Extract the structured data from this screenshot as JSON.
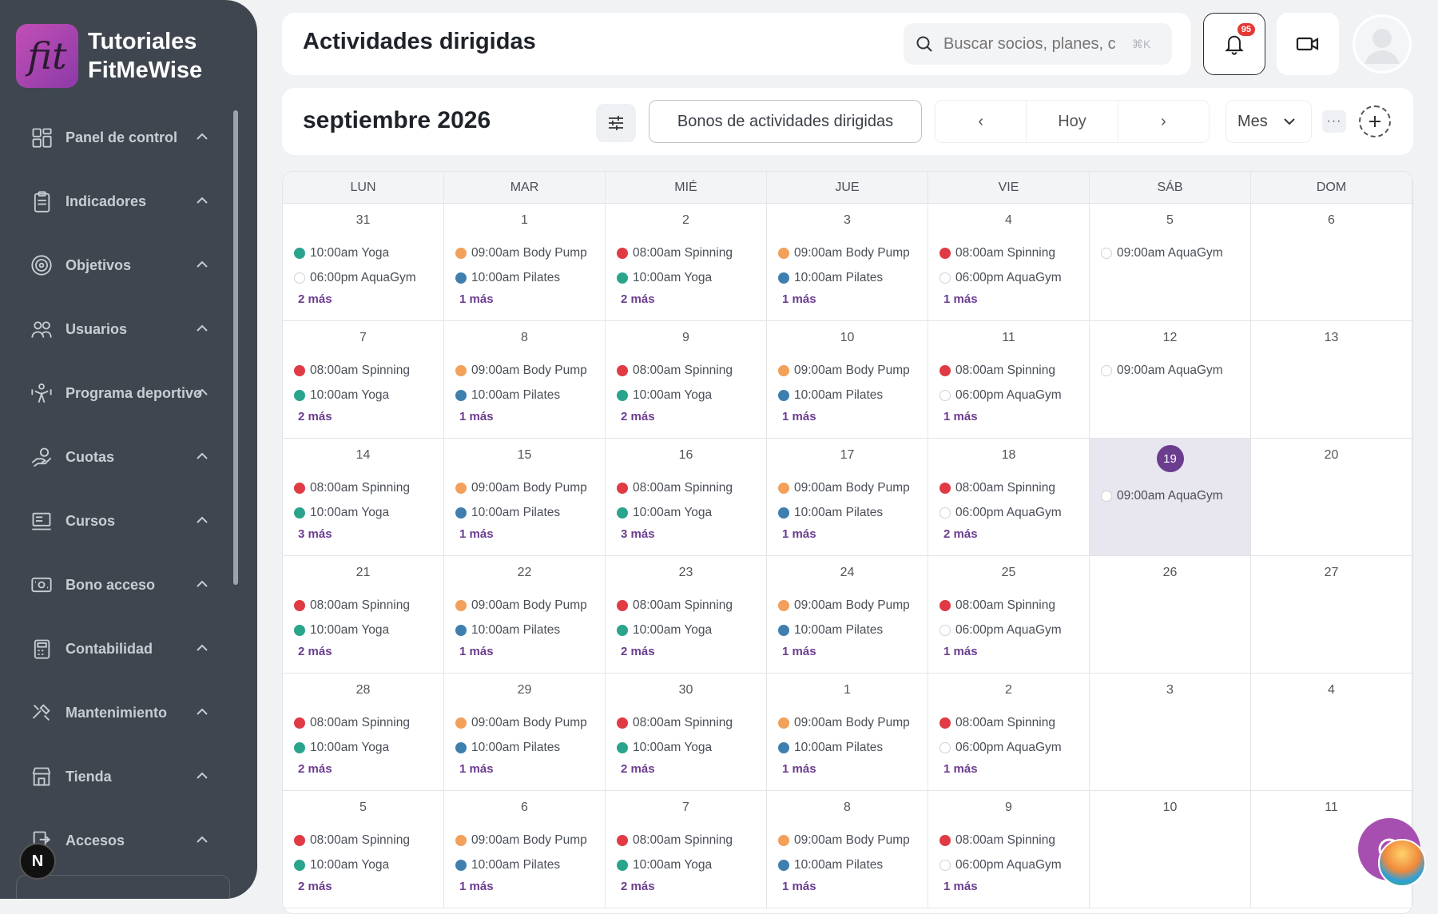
{
  "brand": {
    "logo_text": "fit",
    "name_line1": "Tutoriales",
    "name_line2": "FitMeWise"
  },
  "sidebar": {
    "items": [
      {
        "label": "Panel de control",
        "icon": "dashboard-icon"
      },
      {
        "label": "Indicadores",
        "icon": "clipboard-icon"
      },
      {
        "label": "Objetivos",
        "icon": "target-icon"
      },
      {
        "label": "Usuarios",
        "icon": "users-icon"
      },
      {
        "label": "Programa deportivo",
        "icon": "workout-icon"
      },
      {
        "label": "Cuotas",
        "icon": "hand-coin-icon"
      },
      {
        "label": "Cursos",
        "icon": "course-icon"
      },
      {
        "label": "Bono acceso",
        "icon": "ticket-icon"
      },
      {
        "label": "Contabilidad",
        "icon": "accounting-icon"
      },
      {
        "label": "Mantenimiento",
        "icon": "tools-icon"
      },
      {
        "label": "Tienda",
        "icon": "store-icon"
      },
      {
        "label": "Accesos",
        "icon": "access-icon"
      }
    ],
    "n_badge": "N"
  },
  "header": {
    "title": "Actividades dirigidas",
    "search_placeholder": "Buscar socios, planes, c",
    "search_kbd": "⌘K",
    "notifications": "95"
  },
  "toolbar": {
    "month": "septiembre 2026",
    "bonos_label": "Bonos de actividades dirigidas",
    "prev": "‹",
    "today": "Hoy",
    "next": "›",
    "view": "Mes",
    "more": "···"
  },
  "calendar": {
    "weekdays": [
      "LUN",
      "MAR",
      "MIÉ",
      "JUE",
      "VIE",
      "SÁB",
      "DOM"
    ],
    "colors": {
      "red": "#e03a45",
      "orange": "#f2a05a",
      "teal": "#2aa48c",
      "blue": "#3f7fb0",
      "empty": "#ffffff",
      "accent": "#6b3d8f"
    },
    "weeks": [
      [
        {
          "day": "31",
          "events": [
            [
              "teal",
              "10:00am Yoga"
            ],
            [
              "empty",
              "06:00pm AquaGym"
            ]
          ],
          "more": "2 más"
        },
        {
          "day": "1",
          "events": [
            [
              "orange",
              "09:00am Body Pump"
            ],
            [
              "blue",
              "10:00am Pilates"
            ]
          ],
          "more": "1 más"
        },
        {
          "day": "2",
          "events": [
            [
              "red",
              "08:00am Spinning"
            ],
            [
              "teal",
              "10:00am Yoga"
            ]
          ],
          "more": "2 más"
        },
        {
          "day": "3",
          "events": [
            [
              "orange",
              "09:00am Body Pump"
            ],
            [
              "blue",
              "10:00am Pilates"
            ]
          ],
          "more": "1 más"
        },
        {
          "day": "4",
          "events": [
            [
              "red",
              "08:00am Spinning"
            ],
            [
              "empty",
              "06:00pm AquaGym"
            ]
          ],
          "more": "1 más"
        },
        {
          "day": "5",
          "events": [
            [
              "empty",
              "09:00am AquaGym"
            ]
          ],
          "more": ""
        },
        {
          "day": "6",
          "events": [],
          "more": ""
        }
      ],
      [
        {
          "day": "7",
          "events": [
            [
              "red",
              "08:00am Spinning"
            ],
            [
              "teal",
              "10:00am Yoga"
            ]
          ],
          "more": "2 más"
        },
        {
          "day": "8",
          "events": [
            [
              "orange",
              "09:00am Body Pump"
            ],
            [
              "blue",
              "10:00am Pilates"
            ]
          ],
          "more": "1 más"
        },
        {
          "day": "9",
          "events": [
            [
              "red",
              "08:00am Spinning"
            ],
            [
              "teal",
              "10:00am Yoga"
            ]
          ],
          "more": "2 más"
        },
        {
          "day": "10",
          "events": [
            [
              "orange",
              "09:00am Body Pump"
            ],
            [
              "blue",
              "10:00am Pilates"
            ]
          ],
          "more": "1 más"
        },
        {
          "day": "11",
          "events": [
            [
              "red",
              "08:00am Spinning"
            ],
            [
              "empty",
              "06:00pm AquaGym"
            ]
          ],
          "more": "1 más"
        },
        {
          "day": "12",
          "events": [
            [
              "empty",
              "09:00am AquaGym"
            ]
          ],
          "more": ""
        },
        {
          "day": "13",
          "events": [],
          "more": ""
        }
      ],
      [
        {
          "day": "14",
          "events": [
            [
              "red",
              "08:00am Spinning"
            ],
            [
              "teal",
              "10:00am Yoga"
            ]
          ],
          "more": "3 más"
        },
        {
          "day": "15",
          "events": [
            [
              "orange",
              "09:00am Body Pump"
            ],
            [
              "blue",
              "10:00am Pilates"
            ]
          ],
          "more": "1 más"
        },
        {
          "day": "16",
          "events": [
            [
              "red",
              "08:00am Spinning"
            ],
            [
              "teal",
              "10:00am Yoga"
            ]
          ],
          "more": "3 más"
        },
        {
          "day": "17",
          "events": [
            [
              "orange",
              "09:00am Body Pump"
            ],
            [
              "blue",
              "10:00am Pilates"
            ]
          ],
          "more": "1 más"
        },
        {
          "day": "18",
          "events": [
            [
              "red",
              "08:00am Spinning"
            ],
            [
              "empty",
              "06:00pm AquaGym"
            ]
          ],
          "more": "2 más"
        },
        {
          "day": "19",
          "today": true,
          "events": [
            [
              "empty",
              "09:00am AquaGym"
            ]
          ],
          "more": ""
        },
        {
          "day": "20",
          "events": [],
          "more": ""
        }
      ],
      [
        {
          "day": "21",
          "events": [
            [
              "red",
              "08:00am Spinning"
            ],
            [
              "teal",
              "10:00am Yoga"
            ]
          ],
          "more": "2 más"
        },
        {
          "day": "22",
          "events": [
            [
              "orange",
              "09:00am Body Pump"
            ],
            [
              "blue",
              "10:00am Pilates"
            ]
          ],
          "more": "1 más"
        },
        {
          "day": "23",
          "events": [
            [
              "red",
              "08:00am Spinning"
            ],
            [
              "teal",
              "10:00am Yoga"
            ]
          ],
          "more": "2 más"
        },
        {
          "day": "24",
          "events": [
            [
              "orange",
              "09:00am Body Pump"
            ],
            [
              "blue",
              "10:00am Pilates"
            ]
          ],
          "more": "1 más"
        },
        {
          "day": "25",
          "events": [
            [
              "red",
              "08:00am Spinning"
            ],
            [
              "empty",
              "06:00pm AquaGym"
            ]
          ],
          "more": "1 más"
        },
        {
          "day": "26",
          "events": [],
          "more": ""
        },
        {
          "day": "27",
          "events": [],
          "more": ""
        }
      ],
      [
        {
          "day": "28",
          "events": [
            [
              "red",
              "08:00am Spinning"
            ],
            [
              "teal",
              "10:00am Yoga"
            ]
          ],
          "more": "2 más"
        },
        {
          "day": "29",
          "events": [
            [
              "orange",
              "09:00am Body Pump"
            ],
            [
              "blue",
              "10:00am Pilates"
            ]
          ],
          "more": "1 más"
        },
        {
          "day": "30",
          "events": [
            [
              "red",
              "08:00am Spinning"
            ],
            [
              "teal",
              "10:00am Yoga"
            ]
          ],
          "more": "2 más"
        },
        {
          "day": "1",
          "events": [
            [
              "orange",
              "09:00am Body Pump"
            ],
            [
              "blue",
              "10:00am Pilates"
            ]
          ],
          "more": "1 más"
        },
        {
          "day": "2",
          "events": [
            [
              "red",
              "08:00am Spinning"
            ],
            [
              "empty",
              "06:00pm AquaGym"
            ]
          ],
          "more": "1 más"
        },
        {
          "day": "3",
          "events": [],
          "more": ""
        },
        {
          "day": "4",
          "events": [],
          "more": ""
        }
      ],
      [
        {
          "day": "5",
          "events": [
            [
              "red",
              "08:00am Spinning"
            ],
            [
              "teal",
              "10:00am Yoga"
            ]
          ],
          "more": "2 más"
        },
        {
          "day": "6",
          "events": [
            [
              "orange",
              "09:00am Body Pump"
            ],
            [
              "blue",
              "10:00am Pilates"
            ]
          ],
          "more": "1 más"
        },
        {
          "day": "7",
          "events": [
            [
              "red",
              "08:00am Spinning"
            ],
            [
              "teal",
              "10:00am Yoga"
            ]
          ],
          "more": "2 más"
        },
        {
          "day": "8",
          "events": [
            [
              "orange",
              "09:00am Body Pump"
            ],
            [
              "blue",
              "10:00am Pilates"
            ]
          ],
          "more": "1 más"
        },
        {
          "day": "9",
          "events": [
            [
              "red",
              "08:00am Spinning"
            ],
            [
              "empty",
              "06:00pm AquaGym"
            ]
          ],
          "more": "1 más"
        },
        {
          "day": "10",
          "events": [],
          "more": ""
        },
        {
          "day": "11",
          "events": [],
          "more": ""
        }
      ]
    ]
  }
}
